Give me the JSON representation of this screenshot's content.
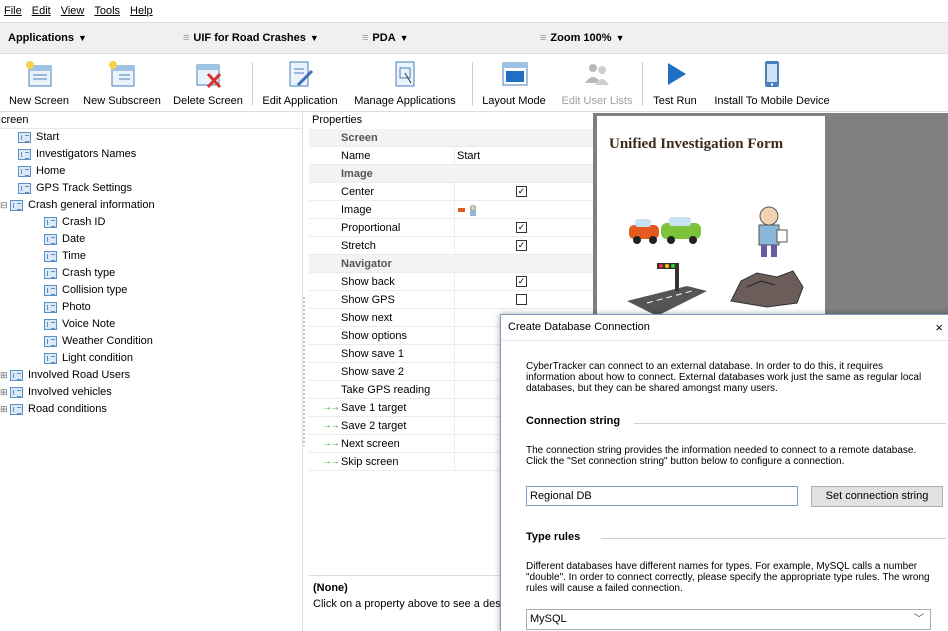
{
  "menu": [
    "File",
    "Edit",
    "View",
    "Tools",
    "Help"
  ],
  "selectors": {
    "applications": "Applications",
    "form": "UIF for Road Crashes",
    "device": "PDA",
    "zoom": "Zoom 100%"
  },
  "toolbar": {
    "new_screen": "New Screen",
    "new_subscreen": "New Subscreen",
    "delete_screen": "Delete Screen",
    "edit_application": "Edit Application",
    "manage_applications": "Manage Applications",
    "layout_mode": "Layout Mode",
    "edit_user_lists": "Edit User Lists",
    "test_run": "Test Run",
    "install": "Install To Mobile Device"
  },
  "tree": {
    "title": "creen",
    "items": [
      {
        "label": "Start",
        "toggle": ""
      },
      {
        "label": "Investigators Names",
        "toggle": ""
      },
      {
        "label": "Home",
        "toggle": ""
      },
      {
        "label": "GPS Track Settings",
        "toggle": ""
      },
      {
        "label": "Crash general information",
        "toggle": "⊟"
      },
      {
        "label": "Crash ID",
        "toggle": ""
      },
      {
        "label": "Date",
        "toggle": ""
      },
      {
        "label": "Time",
        "toggle": ""
      },
      {
        "label": "Crash type",
        "toggle": ""
      },
      {
        "label": "Collision type",
        "toggle": ""
      },
      {
        "label": "Photo",
        "toggle": ""
      },
      {
        "label": "Voice Note",
        "toggle": ""
      },
      {
        "label": "Weather Condition",
        "toggle": ""
      },
      {
        "label": "Light condition",
        "toggle": ""
      },
      {
        "label": "Involved Road Users",
        "toggle": "⊞"
      },
      {
        "label": "Involved vehicles",
        "toggle": "⊞"
      },
      {
        "label": "Road conditions",
        "toggle": "⊞"
      }
    ]
  },
  "properties": {
    "title": "Properties",
    "rows": [
      {
        "name": "Screen",
        "type": "category"
      },
      {
        "name": "Name",
        "type": "text",
        "value": "Start"
      },
      {
        "name": "Image",
        "type": "category"
      },
      {
        "name": "Center",
        "type": "check",
        "checked": true
      },
      {
        "name": "Image",
        "type": "image"
      },
      {
        "name": "Proportional",
        "type": "check",
        "checked": true
      },
      {
        "name": "Stretch",
        "type": "check",
        "checked": true
      },
      {
        "name": "Navigator",
        "type": "category"
      },
      {
        "name": "Show back",
        "type": "check",
        "checked": true
      },
      {
        "name": "Show GPS",
        "type": "check",
        "checked": false
      },
      {
        "name": "Show next",
        "type": "plain"
      },
      {
        "name": "Show options",
        "type": "plain"
      },
      {
        "name": "Show save 1",
        "type": "plain"
      },
      {
        "name": "Show save 2",
        "type": "plain"
      },
      {
        "name": "Take GPS reading",
        "type": "plain"
      },
      {
        "name": "Save 1 target",
        "type": "target"
      },
      {
        "name": "Save 2 target",
        "type": "target"
      },
      {
        "name": "Next screen",
        "type": "target"
      },
      {
        "name": "Skip screen",
        "type": "target"
      }
    ],
    "desc_title": "(None)",
    "desc_text": "Click on a property above to see a descrip"
  },
  "preview": {
    "form_title": "Unified Investigation Form"
  },
  "dialog": {
    "title": "Create Database Connection",
    "close": "×",
    "intro": "CyberTracker can connect to an external database. In order to do this, it requires information about how to connect. External databases work just the same as regular local databases, but they can be shared amongst many users.",
    "conn_heading": "Connection string",
    "conn_text": "The connection string provides the information needed to connect to a remote database. Click the \"Set connection string\" button below to configure a connection.",
    "conn_value": "Regional DB",
    "set_button": "Set connection string",
    "type_heading": "Type rules",
    "type_text": "Different databases have different names for types. For example, MySQL calls a number \"double\". In order to connect correctly, please specify the appropriate type rules. The wrong rules will cause a failed connection.",
    "type_value": "MySQL"
  },
  "colors": {
    "accent": "#1e6fc5",
    "preview_bg": "#808080",
    "arrow": "#39a839"
  }
}
